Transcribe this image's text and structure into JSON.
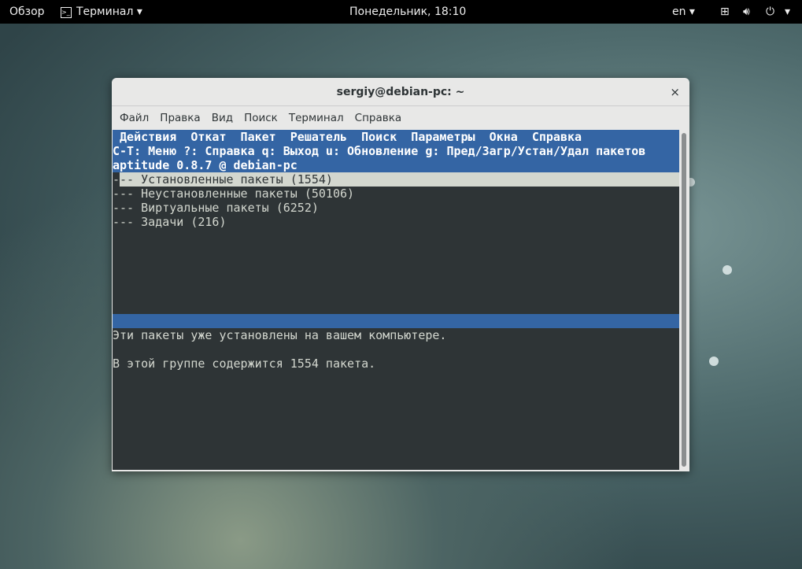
{
  "topbar": {
    "overview": "Обзор",
    "app": "Терминал ▾",
    "clock": "Понедельник, 18:10",
    "lang": "en ▾",
    "power_menu": "▾"
  },
  "window": {
    "title": "sergiy@debian-pc: ~",
    "close": "×",
    "menu": [
      "Файл",
      "Правка",
      "Вид",
      "Поиск",
      "Терминал",
      "Справка"
    ]
  },
  "aptitude": {
    "menu_line": " Действия  Откат  Пакет  Решатель  Поиск  Параметры  Окна  Справка",
    "help_line": "C-T: Меню ?: Справка q: Выход u: Обновление g: Пред/Загр/Устан/Удал пакетов",
    "version_line": "aptitude 0.8.7 @ debian-pc",
    "tree_prefix": "-",
    "tree": [
      "-- Установленные пакеты (1554)",
      "--- Неустановленные пакеты (50106)",
      "--- Виртуальные пакеты (6252)",
      "--- Задачи (216)"
    ],
    "desc1": "Эти пакеты уже установлены на вашем компьютере.",
    "desc2": "В этой группе содержится 1554 пакета."
  }
}
